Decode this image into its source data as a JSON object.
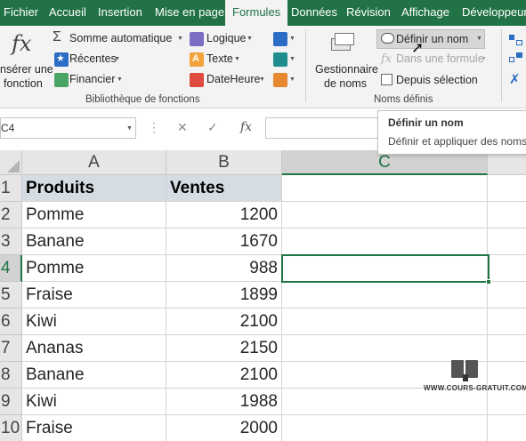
{
  "ribbon_tabs": [
    "Fichier",
    "Accueil",
    "Insertion",
    "Mise en page",
    "Formules",
    "Données",
    "Révision",
    "Affichage",
    "Développeur"
  ],
  "active_tab": "Formules",
  "ribbon": {
    "insert_function": {
      "line1": "nsérer une",
      "line2": "fonction"
    },
    "library": {
      "autosum": "Somme automatique",
      "recent": "Récentes",
      "financial": "Financier",
      "logical": "Logique",
      "text": "Texte",
      "datetime": "DateHeure",
      "group_label": "Bibliothèque de fonctions"
    },
    "names": {
      "manager_line1": "Gestionnaire",
      "manager_line2": "de noms",
      "define_name": "Définir un nom",
      "use_in_formula": "Dans une formule",
      "create_from_selection": "Depuis sélection",
      "group_label": "Noms définis"
    }
  },
  "tooltip": {
    "title": "Définir un nom",
    "description": "Définir et appliquer des noms"
  },
  "formula_bar": {
    "name_box": "C4",
    "cancel": "✕",
    "enter": "✓",
    "fx": "fx",
    "content": ""
  },
  "columns": [
    "A",
    "B",
    "C"
  ],
  "rows": [
    "1",
    "2",
    "3",
    "4",
    "5",
    "6",
    "7",
    "8",
    "9",
    "10"
  ],
  "table": {
    "headers": [
      "Produits",
      "Ventes"
    ],
    "data": [
      [
        "Pomme",
        "1200"
      ],
      [
        "Banane",
        "1670"
      ],
      [
        "Pomme",
        "988"
      ],
      [
        "Fraise",
        "1899"
      ],
      [
        "Kiwi",
        "2100"
      ],
      [
        "Ananas",
        "2150"
      ],
      [
        "Banane",
        "2100"
      ],
      [
        "Kiwi",
        "1988"
      ],
      [
        "Fraise",
        "2000"
      ]
    ]
  },
  "selected_cell": "C4",
  "watermark": "WWW.COURS-GRATUIT.COM",
  "colors": {
    "accent": "#217346",
    "header_fill": "#d6dce4"
  }
}
